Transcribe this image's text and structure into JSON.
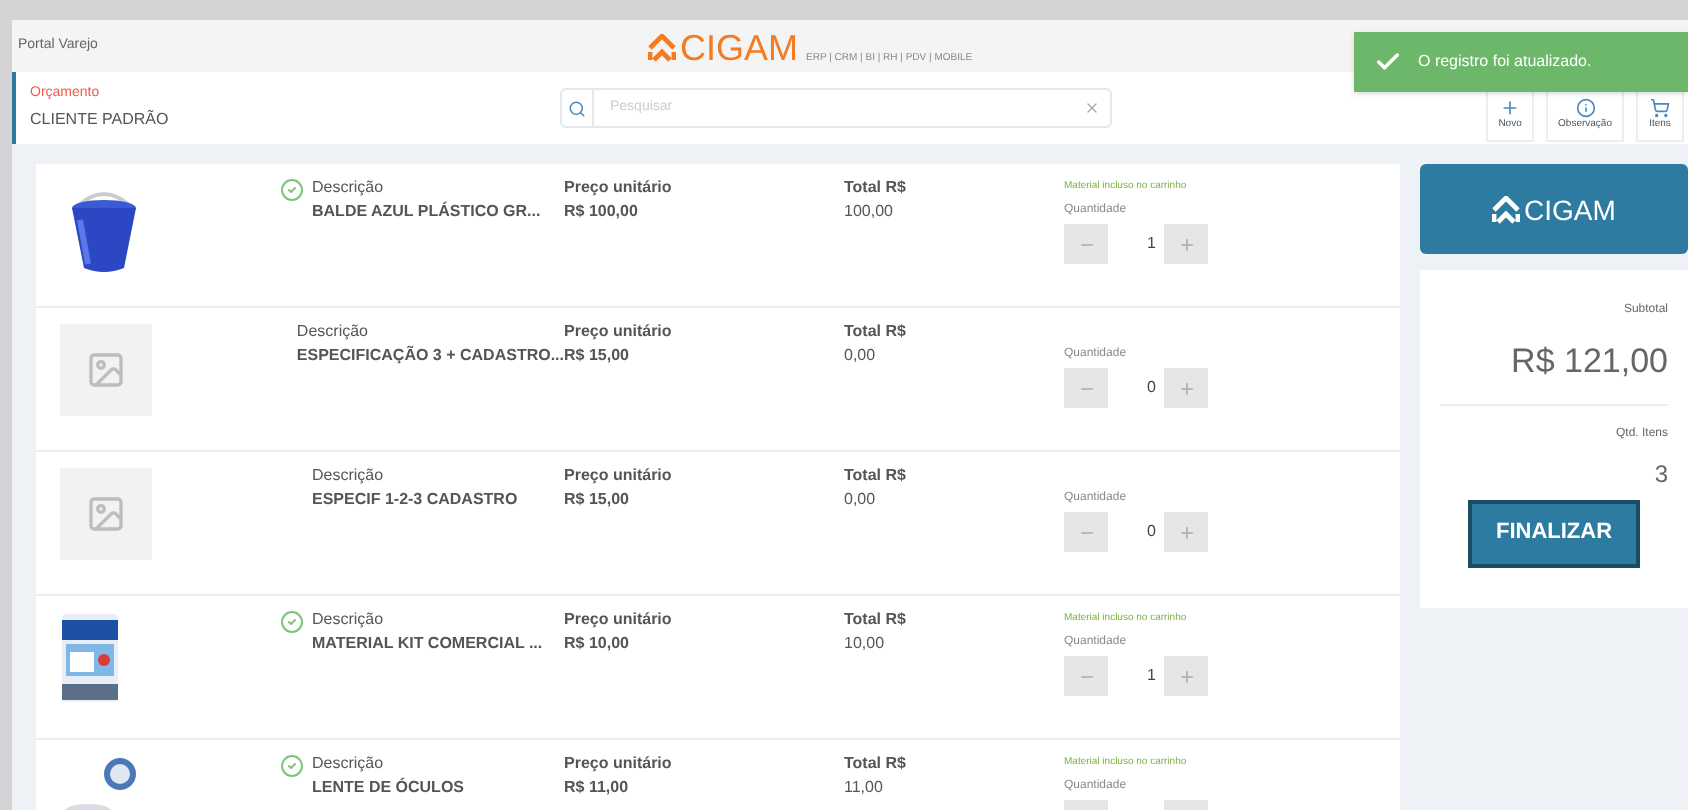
{
  "app_bar": {
    "title": "Portal Varejo",
    "logo": "CIGAM",
    "tagline": "ERP | CRM | BI | RH | PDV | MOBILE"
  },
  "toast": {
    "message": "O registro foi atualizado."
  },
  "header": {
    "subtitle": "Orçamento",
    "customer": "CLIENTE PADRÃO",
    "search": {
      "placeholder": "Pesquisar"
    },
    "actions": [
      {
        "kind": "new",
        "label": "Novo"
      },
      {
        "kind": "info",
        "label": "Observação"
      },
      {
        "kind": "cart",
        "label": "Itens"
      }
    ]
  },
  "items": [
    {
      "kind": "picture",
      "in_cart": true,
      "description_label": "Descrição",
      "description": "BALDE AZUL PLÁSTICO GR...",
      "price_label": "Preço unitário",
      "price": "R$ 100,00",
      "total_label": "Total R$",
      "total": "100,00",
      "note": "Material incluso no carrinho",
      "quantity_label": "Quantidade",
      "quantity": "1"
    },
    {
      "kind": "placeholder",
      "in_cart": false,
      "description_label": "Descrição",
      "description": "ESPECIFICAÇÃO 3 + CADASTRO...",
      "price_label": "Preço unitário",
      "price": "R$ 15,00",
      "total_label": "Total R$",
      "total": "0,00",
      "quantity_label": "Quantidade",
      "quantity": "0"
    },
    {
      "kind": "placeholder",
      "in_cart": false,
      "description_label": "Descrição",
      "description": "ESPECIF 1-2-3 CADASTRO",
      "price_label": "Preço unitário",
      "price": "R$ 15,00",
      "total_label": "Total R$",
      "total": "0,00",
      "quantity_label": "Quantidade",
      "quantity": "0"
    },
    {
      "kind": "picture",
      "in_cart": true,
      "description_label": "Descrição",
      "description": "MATERIAL KIT COMERCIAL ...",
      "price_label": "Preço unitário",
      "price": "R$ 10,00",
      "total_label": "Total R$",
      "total": "10,00",
      "note": "Material incluso no carrinho",
      "quantity_label": "Quantidade",
      "quantity": "1"
    },
    {
      "kind": "picture",
      "in_cart": true,
      "description_label": "Descrição",
      "description": "LENTE DE ÓCULOS",
      "price_label": "Preço unitário",
      "price": "R$ 11,00",
      "total_label": "Total R$",
      "total": "11,00",
      "note": "Material incluso no carrinho",
      "quantity_label": "Quantidade"
    }
  ],
  "summary": {
    "logo": "CIGAM",
    "subtotal_label": "Subtotal",
    "subtotal": "R$ 121,00",
    "count_label": "Qtd. Itens",
    "count": "3",
    "button": "FINALIZAR"
  }
}
